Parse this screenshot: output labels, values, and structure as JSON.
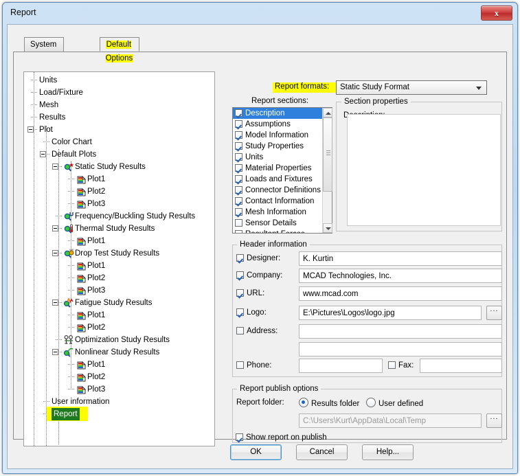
{
  "window": {
    "title": "Report",
    "close_icon": "close-icon",
    "close_label": "x"
  },
  "tabs": [
    {
      "label": "System Options",
      "active": false,
      "highlighted": false
    },
    {
      "label": "Default Options",
      "active": true,
      "highlighted": true
    }
  ],
  "tree": {
    "items": [
      {
        "label": "Units",
        "depth": 1,
        "expander": "none"
      },
      {
        "label": "Load/Fixture",
        "depth": 1,
        "expander": "none"
      },
      {
        "label": "Mesh",
        "depth": 1,
        "expander": "none"
      },
      {
        "label": "Results",
        "depth": 1,
        "expander": "none"
      },
      {
        "label": "Plot",
        "depth": 1,
        "expander": "minus"
      },
      {
        "label": "Color Chart",
        "depth": 2,
        "expander": "none"
      },
      {
        "label": "Default Plots",
        "depth": 2,
        "expander": "minus"
      },
      {
        "label": "Static Study Results",
        "depth": 3,
        "expander": "minus",
        "icon": "static-study-icon"
      },
      {
        "label": "Plot1",
        "depth": 4,
        "expander": "none",
        "icon": "plot-icon"
      },
      {
        "label": "Plot2",
        "depth": 4,
        "expander": "none",
        "icon": "plot-icon"
      },
      {
        "label": "Plot3",
        "depth": 4,
        "expander": "none",
        "icon": "plot-icon"
      },
      {
        "label": "Frequency/Buckling Study Results",
        "depth": 3,
        "expander": "none",
        "icon": "frequency-study-icon"
      },
      {
        "label": "Thermal Study Results",
        "depth": 3,
        "expander": "minus",
        "icon": "thermal-study-icon"
      },
      {
        "label": "Plot1",
        "depth": 4,
        "expander": "none",
        "icon": "plot-icon"
      },
      {
        "label": "Drop Test Study Results",
        "depth": 3,
        "expander": "minus",
        "icon": "droptest-study-icon"
      },
      {
        "label": "Plot1",
        "depth": 4,
        "expander": "none",
        "icon": "plot-icon"
      },
      {
        "label": "Plot2",
        "depth": 4,
        "expander": "none",
        "icon": "plot-icon"
      },
      {
        "label": "Plot3",
        "depth": 4,
        "expander": "none",
        "icon": "plot-icon"
      },
      {
        "label": "Fatigue Study Results",
        "depth": 3,
        "expander": "minus",
        "icon": "fatigue-study-icon"
      },
      {
        "label": "Plot1",
        "depth": 4,
        "expander": "none",
        "icon": "plot-icon"
      },
      {
        "label": "Plot2",
        "depth": 4,
        "expander": "none",
        "icon": "plot-icon"
      },
      {
        "label": "Optimization Study Results",
        "depth": 3,
        "expander": "none",
        "icon": "optimization-study-icon"
      },
      {
        "label": "Nonlinear Study Results",
        "depth": 3,
        "expander": "minus",
        "icon": "nonlinear-study-icon"
      },
      {
        "label": "Plot1",
        "depth": 4,
        "expander": "none",
        "icon": "plot-icon"
      },
      {
        "label": "Plot2",
        "depth": 4,
        "expander": "none",
        "icon": "plot-icon"
      },
      {
        "label": "Plot3",
        "depth": 4,
        "expander": "none",
        "icon": "plot-icon"
      },
      {
        "label": "User information",
        "depth": 2,
        "expander": "none"
      },
      {
        "label": "Report",
        "depth": 2,
        "expander": "none",
        "selected": true,
        "highlighted": true
      }
    ],
    "selection_color": "#1f7a1f",
    "highlight_color": "#ffff00"
  },
  "report_formats": {
    "label": "Report formats:",
    "highlighted": true,
    "selected_format": "Static Study Format",
    "dropdown_icon": "chevron-down-icon"
  },
  "report_sections": {
    "label": "Report sections:",
    "items": [
      {
        "label": "Description",
        "checked": true,
        "selected": true
      },
      {
        "label": "Assumptions",
        "checked": true
      },
      {
        "label": "Model Information",
        "checked": true
      },
      {
        "label": "Study Properties",
        "checked": true
      },
      {
        "label": "Units",
        "checked": true
      },
      {
        "label": "Material Properties",
        "checked": true
      },
      {
        "label": "Loads and Fixtures",
        "checked": true
      },
      {
        "label": "Connector Definitions",
        "checked": true
      },
      {
        "label": "Contact Information",
        "checked": true
      },
      {
        "label": "Mesh Information",
        "checked": true
      },
      {
        "label": "Sensor Details",
        "checked": false
      },
      {
        "label": "Resultant Forces",
        "checked": true
      }
    ],
    "scroll_up_icon": "scroll-up-arrow-icon",
    "scroll_down_icon": "scroll-down-arrow-icon"
  },
  "section_properties": {
    "group_title": "Section properties",
    "description_label": "Description:",
    "description_value": ""
  },
  "header_information": {
    "group_title": "Header information",
    "fields": [
      {
        "label": "Designer:",
        "checked": true,
        "value": "K. Kurtin"
      },
      {
        "label": "Company:",
        "checked": true,
        "value": "MCAD Technologies, Inc."
      },
      {
        "label": "URL:",
        "checked": true,
        "value": "www.mcad.com"
      },
      {
        "label": "Logo:",
        "checked": true,
        "value": "E:\\Pictures\\Logos\\logo.jpg",
        "browse": true
      },
      {
        "label": "Address:",
        "checked": false,
        "value": ""
      },
      {
        "label": "",
        "checked": null,
        "value": ""
      },
      {
        "label": "Phone:",
        "checked": false,
        "value": ""
      }
    ],
    "fax": {
      "label": "Fax:",
      "checked": false,
      "value": ""
    },
    "browse_label": "..."
  },
  "report_publish_options": {
    "group_title": "Report publish options",
    "folder_label": "Report folder:",
    "options": [
      {
        "label": "Results folder",
        "selected": true
      },
      {
        "label": "User defined",
        "selected": false
      }
    ],
    "path_value": "C:\\Users\\Kurt\\AppData\\Local\\Temp",
    "path_disabled": true,
    "browse_label": "...",
    "show_report": {
      "label": "Show report on publish",
      "checked": true
    }
  },
  "buttons": [
    {
      "label": "OK",
      "default": true
    },
    {
      "label": "Cancel",
      "default": false
    },
    {
      "label": "Help...",
      "default": false
    }
  ]
}
